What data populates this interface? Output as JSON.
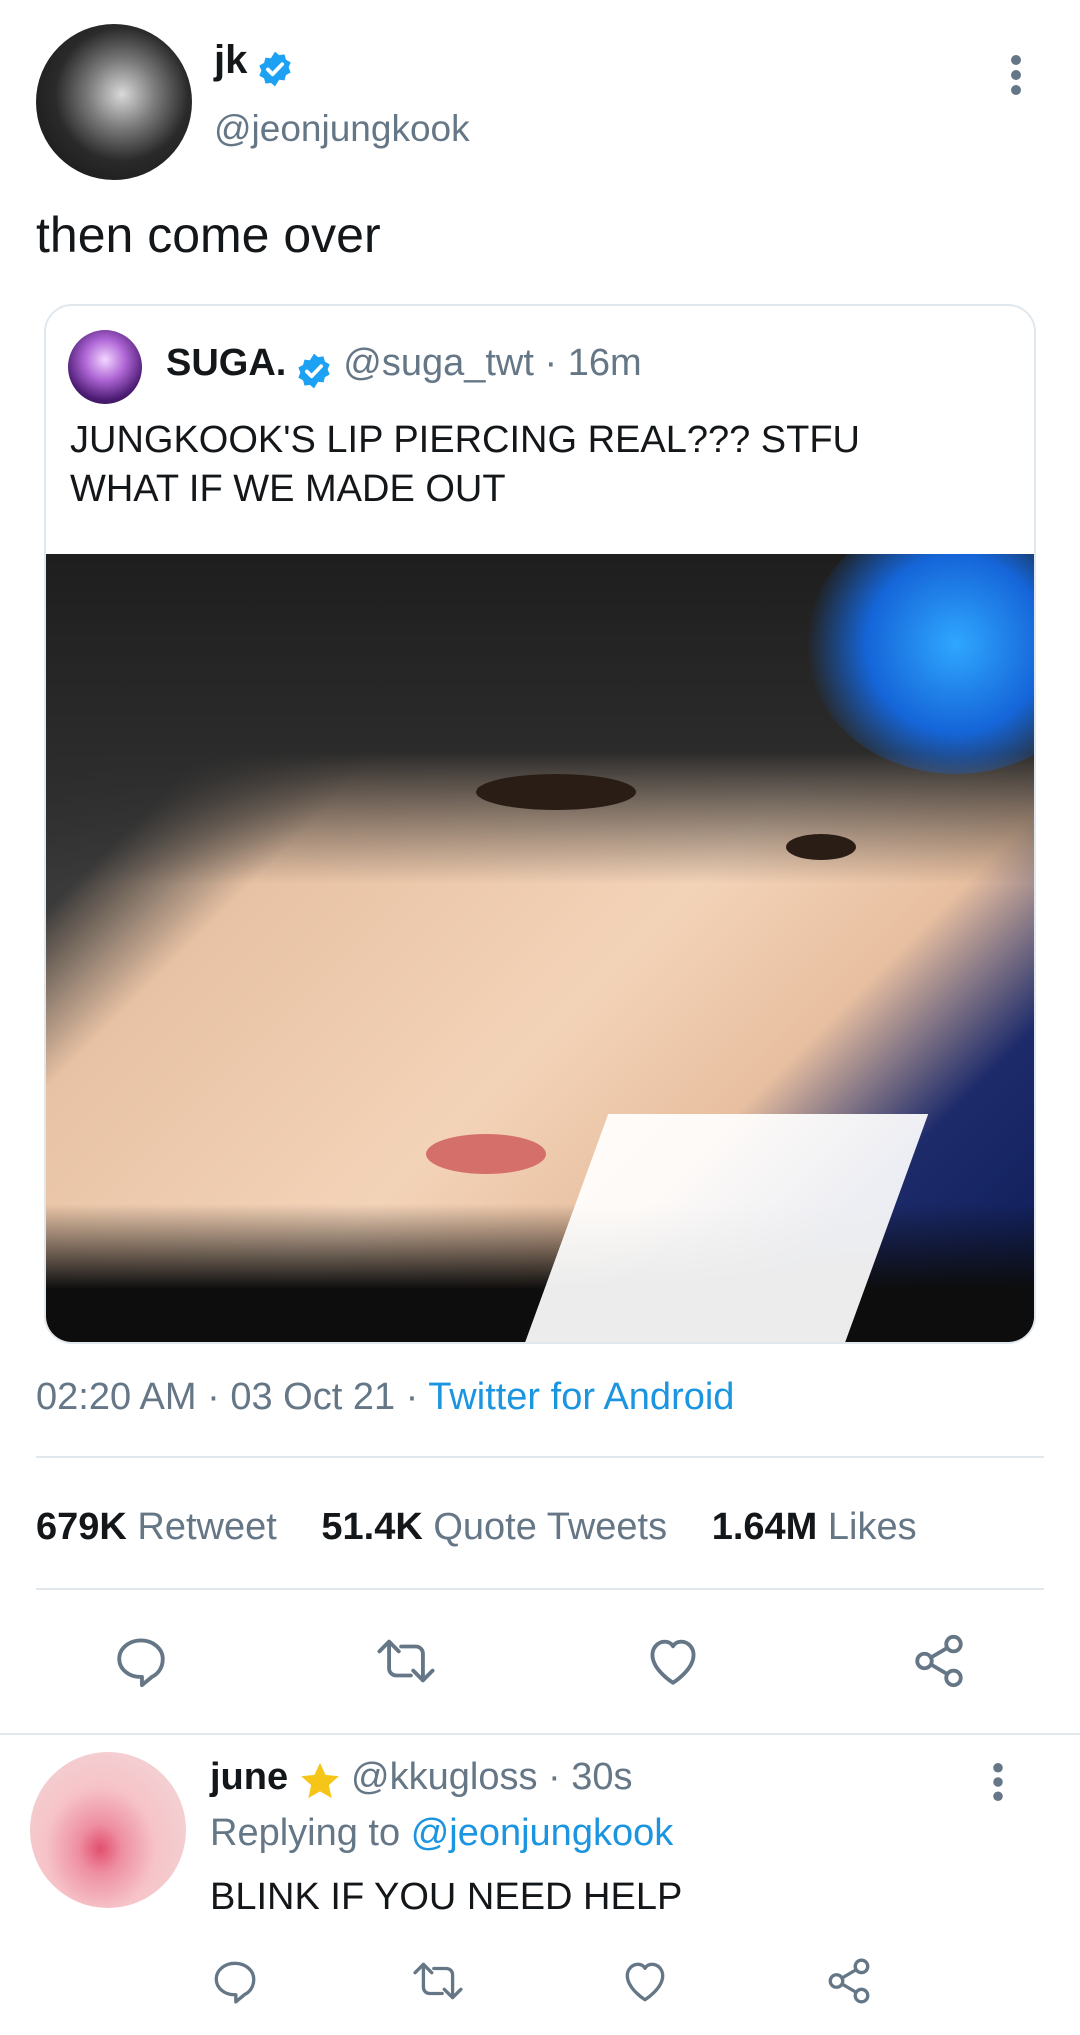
{
  "tweet": {
    "author_name": "jk",
    "author_handle": "@jeonjungkook",
    "text": "then come over",
    "timestamp": "02:20 AM · 03 Oct 21 ·",
    "source": "Twitter for Android"
  },
  "quoted": {
    "author_name": "SUGA.",
    "author_handle": "@suga_twt · 16m",
    "line1": "JUNGKOOK'S LIP PIERCING REAL??? STFU",
    "line2": "WHAT IF WE MADE OUT"
  },
  "stats": {
    "retweets_count": "679K",
    "retweets_label": "Retweet",
    "quotes_count": "51.4K",
    "quotes_label": "Quote Tweets",
    "likes_count": "1.64M",
    "likes_label": "Likes"
  },
  "reply": {
    "author_name": "june",
    "author_handle": "@kkugloss · 30s",
    "replying_prefix": "Replying to",
    "replying_to": "@jeonjungkook",
    "text": "BLINK IF YOU NEED HELP"
  },
  "colors": {
    "accent": "#1b95e0",
    "muted": "#657786",
    "verified": "#1da1f2",
    "star": "#f5c518"
  },
  "icons": [
    "more-vert-icon",
    "verified-icon",
    "reply-icon",
    "retweet-icon",
    "like-icon",
    "share-icon",
    "star-icon"
  ]
}
